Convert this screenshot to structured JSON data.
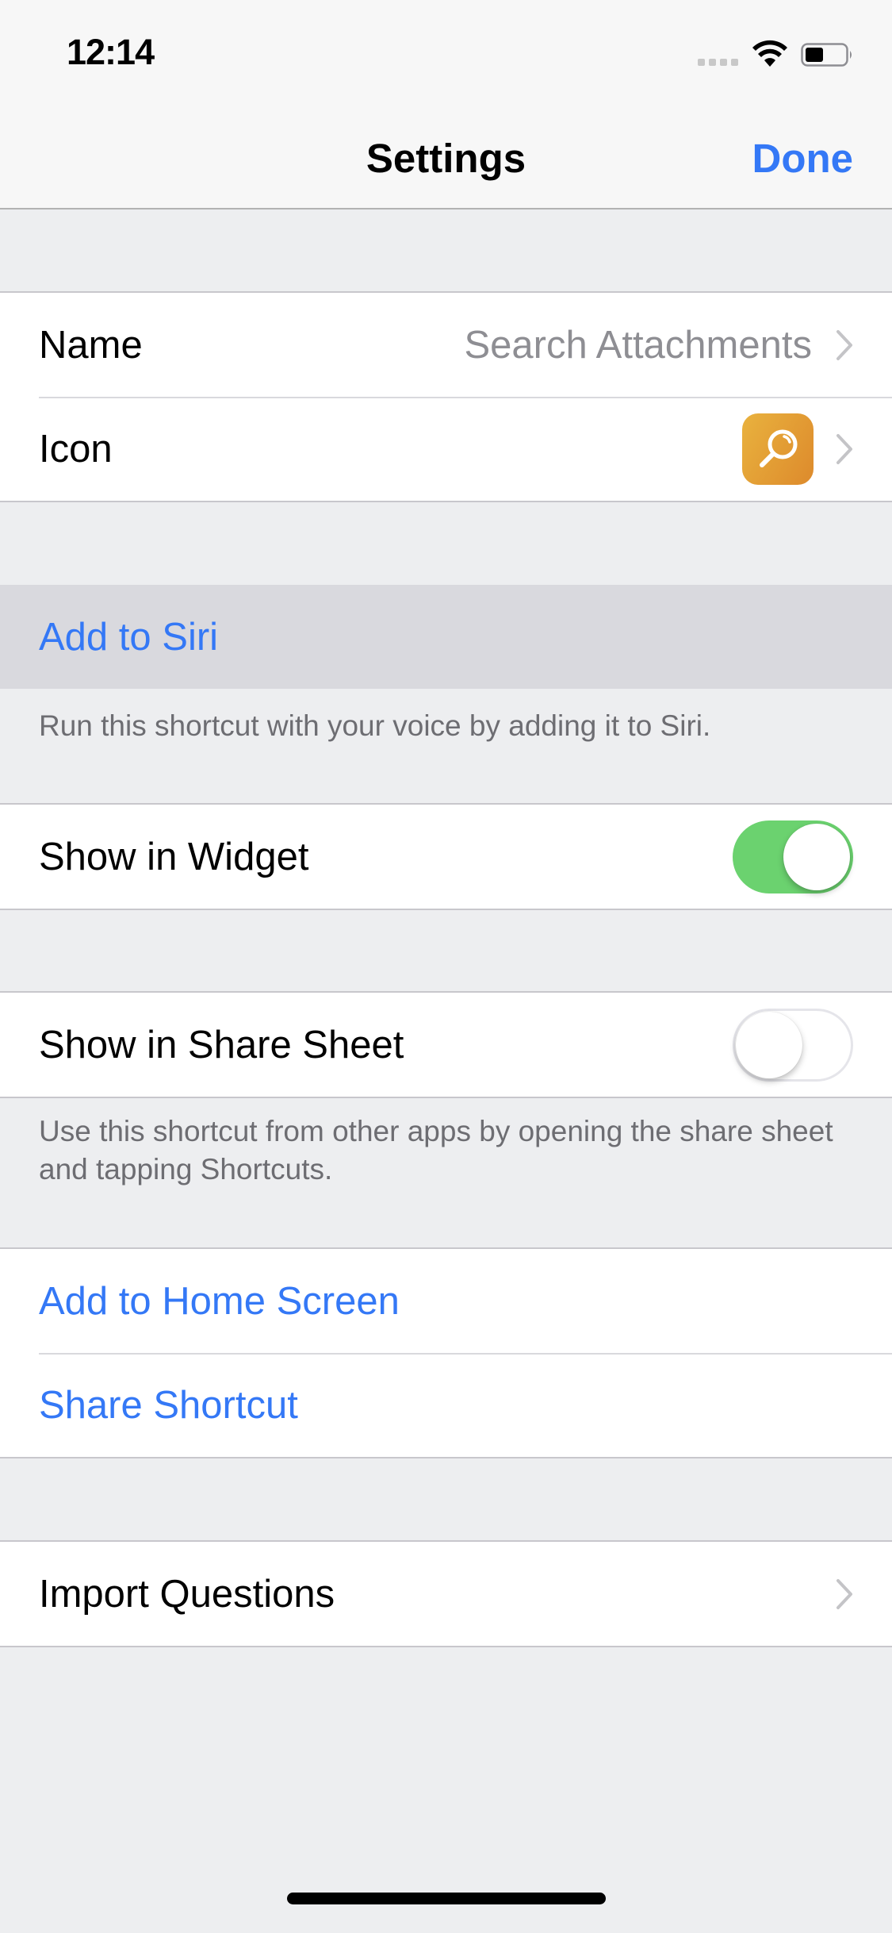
{
  "status_bar": {
    "time": "12:14",
    "signal_icon": "cellular-signal-icon",
    "wifi_icon": "wifi-icon",
    "battery_icon": "battery-icon",
    "battery_level": 0.4
  },
  "nav": {
    "title": "Settings",
    "done_label": "Done"
  },
  "colors": {
    "accent": "#3478F6",
    "toggle_on": "#6BD26F",
    "icon_gradient_start": "#E9B23E",
    "icon_gradient_end": "#DD8A2C",
    "background": "#EDEEF0"
  },
  "sections": {
    "general": {
      "name_label": "Name",
      "name_value": "Search Attachments",
      "icon_label": "Icon",
      "icon_glyph": "magnifying-glass-icon"
    },
    "siri": {
      "add_label": "Add to Siri",
      "footer": "Run this shortcut with your voice by adding it to Siri."
    },
    "widget": {
      "label": "Show in Widget",
      "enabled": true
    },
    "share_sheet": {
      "label": "Show in Share Sheet",
      "enabled": false,
      "footer": "Use this shortcut from other apps by opening the share sheet and tapping Shortcuts."
    },
    "actions": {
      "home_screen_label": "Add to Home Screen",
      "share_label": "Share Shortcut"
    },
    "import": {
      "label": "Import Questions"
    }
  }
}
